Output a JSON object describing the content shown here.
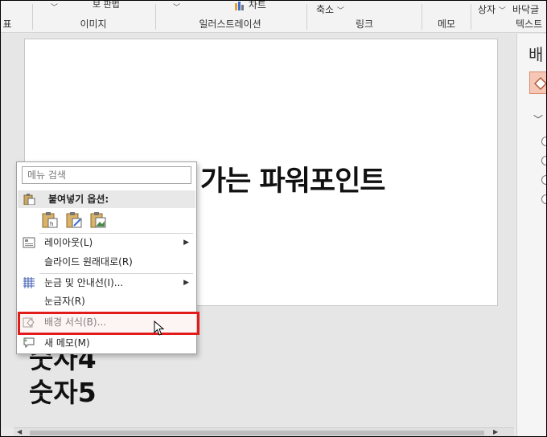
{
  "ribbon": {
    "top_items": [
      {
        "name": "ribbon-top-partial",
        "text": "보 판법"
      },
      {
        "name": "ribbon-top-chart",
        "text": "차트"
      },
      {
        "name": "ribbon-top-zoom",
        "text": "축소"
      },
      {
        "name": "ribbon-top-textbox",
        "text": "상자"
      },
      {
        "name": "ribbon-top-footer",
        "text": "바닥글"
      }
    ],
    "groups": {
      "table": "표",
      "images": "이미지",
      "illustrations": "일러스트레이션",
      "links": "링크",
      "comments": "메모",
      "text": "텍스트"
    }
  },
  "slide": {
    "title": "도 리 함 우 리 가는 파워포인트",
    "bullet4": "숫자4",
    "bullet5": "숫자5"
  },
  "pane": {
    "title": "배"
  },
  "context_menu": {
    "search_placeholder": "메뉴 검색",
    "paste_options": "붙여넣기 옵션:",
    "layout": "레이아웃(L)",
    "reset_slide": "슬라이드 원래대로(R)",
    "grid_guides": "눈금 및 안내선(I)...",
    "ruler": "눈금자(R)",
    "format_background": "배경 서식(B)...",
    "new_comment": "새 메모(M)"
  },
  "colors": {
    "highlight": "#e21b1b",
    "pane_fill": "#f6c7b5"
  }
}
